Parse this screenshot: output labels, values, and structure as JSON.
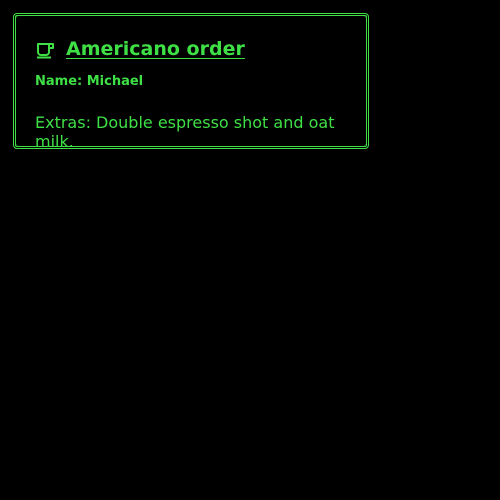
{
  "order": {
    "icon": "coffee-cup-icon",
    "title": "Americano order",
    "name_line": "Name: Michael",
    "extras_line": "Extras: Double espresso shot and oat milk."
  },
  "colors": {
    "accent": "#3fe046",
    "background": "#000000"
  }
}
